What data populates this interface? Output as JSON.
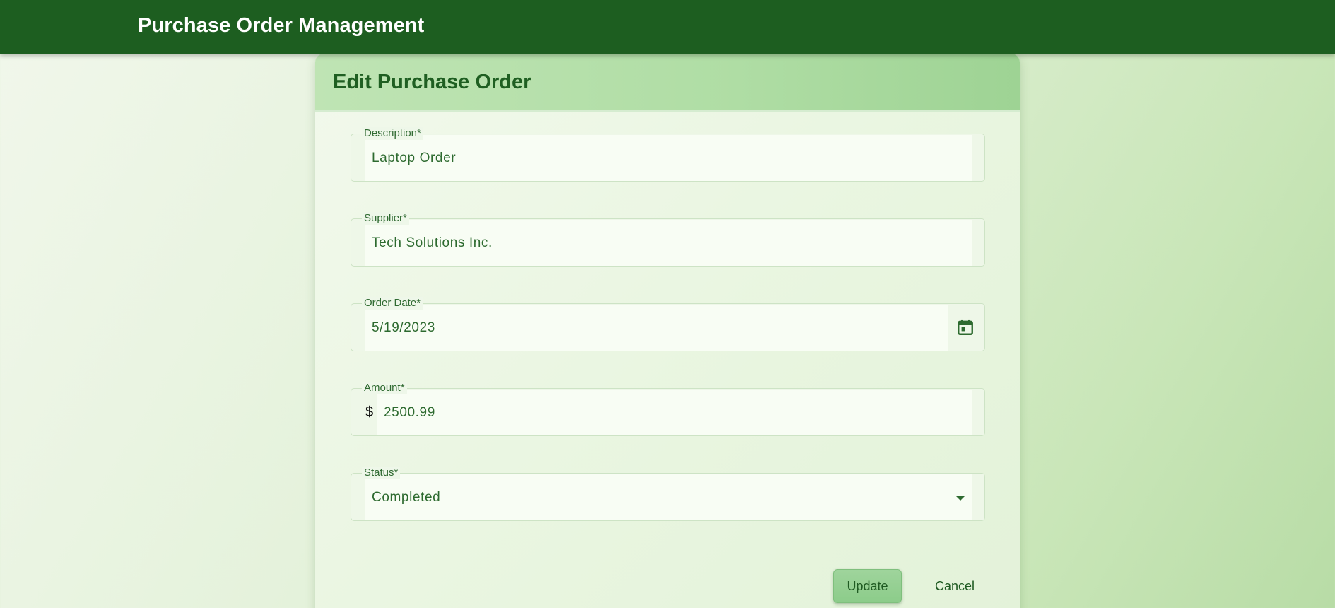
{
  "app": {
    "title": "Purchase Order Management"
  },
  "form": {
    "title": "Edit Purchase Order",
    "description": {
      "label": "Description*",
      "value": "Laptop Order"
    },
    "supplier": {
      "label": "Supplier*",
      "value": "Tech Solutions Inc."
    },
    "order_date": {
      "label": "Order Date*",
      "value": "5/19/2023",
      "icon": "calendar-icon"
    },
    "amount": {
      "label": "Amount*",
      "prefix": "$",
      "value": "2500.99"
    },
    "status": {
      "label": "Status*",
      "value": "Completed",
      "icon": "chevron-down-icon"
    },
    "actions": {
      "update_label": "Update",
      "cancel_label": "Cancel"
    }
  },
  "colors": {
    "header": "#1d5e20",
    "accent": "#2d6a2f",
    "button": "#8ccc8a"
  }
}
